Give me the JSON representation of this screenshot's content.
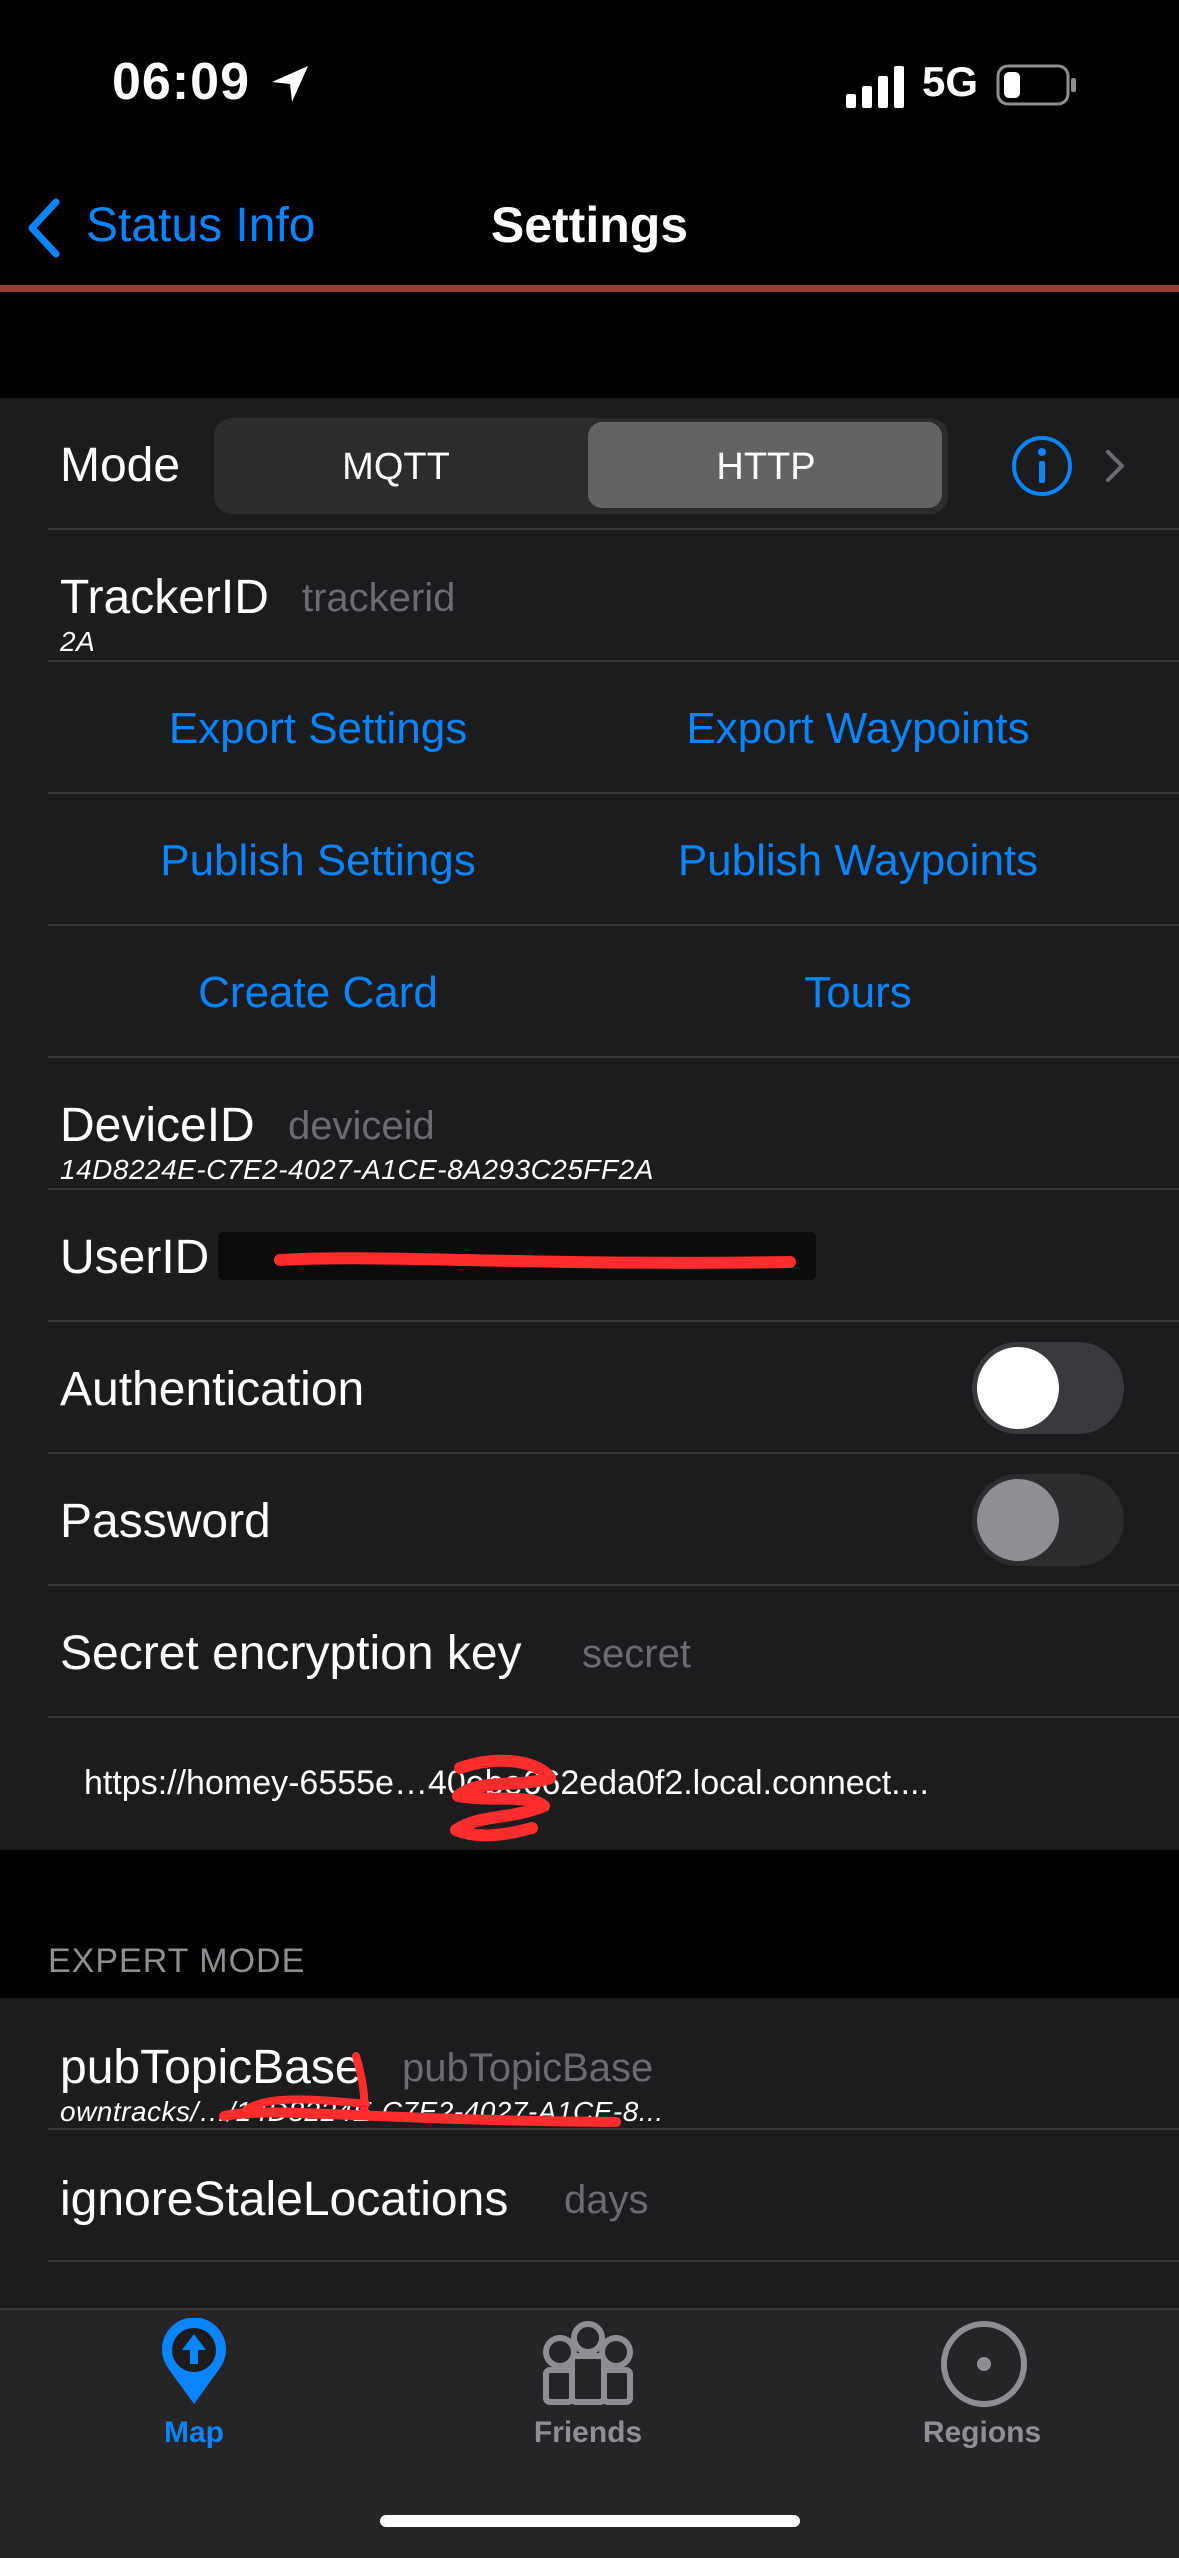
{
  "status_bar": {
    "time": "06:09",
    "network": "5G"
  },
  "nav": {
    "back_label": "Status Info",
    "title": "Settings"
  },
  "mode": {
    "label": "Mode",
    "options": [
      "MQTT",
      "HTTP"
    ],
    "selected": "HTTP"
  },
  "tracker": {
    "label": "TrackerID",
    "placeholder": "trackerid",
    "value": "2A"
  },
  "actions": {
    "export_settings": "Export Settings",
    "export_waypoints": "Export Waypoints",
    "publish_settings": "Publish Settings",
    "publish_waypoints": "Publish Waypoints",
    "create_card": "Create Card",
    "tours": "Tours"
  },
  "device": {
    "label": "DeviceID",
    "placeholder": "deviceid",
    "value": "14D8224E-C7E2-4027-A1CE-8A293C25FF2A"
  },
  "user": {
    "label": "UserID"
  },
  "authentication": {
    "label": "Authentication",
    "on": true
  },
  "password": {
    "label": "Password",
    "on": false
  },
  "secret": {
    "label": "Secret encryption key",
    "placeholder": "secret"
  },
  "url": {
    "value": "https://homey-6555e…40ebe662eda0f2.local.connect...."
  },
  "expert": {
    "header": "EXPERT MODE",
    "pub_topic": {
      "label": "pubTopicBase",
      "placeholder": "pubTopicBase",
      "value": "owntracks/…/14D8224E-C7E2-4027-A1CE-8..."
    },
    "ignore_stale": {
      "label": "ignoreStaleLocations",
      "placeholder": "days"
    }
  },
  "tabs": [
    {
      "label": "Map",
      "icon": "map-pin-icon",
      "active": true
    },
    {
      "label": "Friends",
      "icon": "friends-icon",
      "active": false
    },
    {
      "label": "Regions",
      "icon": "regions-icon",
      "active": false
    }
  ],
  "colors": {
    "accent": "#0a84ff",
    "background": "#000000",
    "cell": "#1c1c1e",
    "progress": "#9a3f30"
  }
}
